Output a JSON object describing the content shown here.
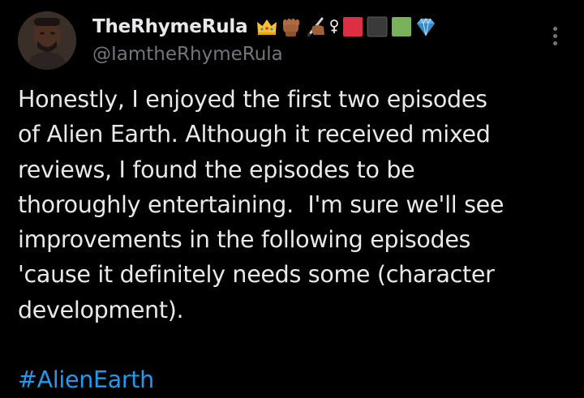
{
  "author": {
    "display_name": "TheRhymeRula",
    "handle": "@IamtheRhymeRula",
    "name_emojis": [
      "crown",
      "raised-fist-brown",
      "writing-hand-brown",
      "female-sign",
      "red-square",
      "black-square",
      "green-square",
      "gem-stone"
    ]
  },
  "tweet": {
    "lines": [
      "Honestly, I enjoyed the first two episodes",
      "of Alien Earth. Although it received mixed",
      "reviews, I found the episodes to be",
      "thoroughly entertaining.  I'm sure we'll see",
      "improvements in the following episodes",
      "'cause it definitely needs some (character",
      "development)."
    ],
    "hashtag": "#AlienEarth"
  },
  "colors": {
    "background": "#000000",
    "text": "#e7e9ea",
    "secondary_text": "#71767b",
    "link": "#1d9bf0"
  }
}
